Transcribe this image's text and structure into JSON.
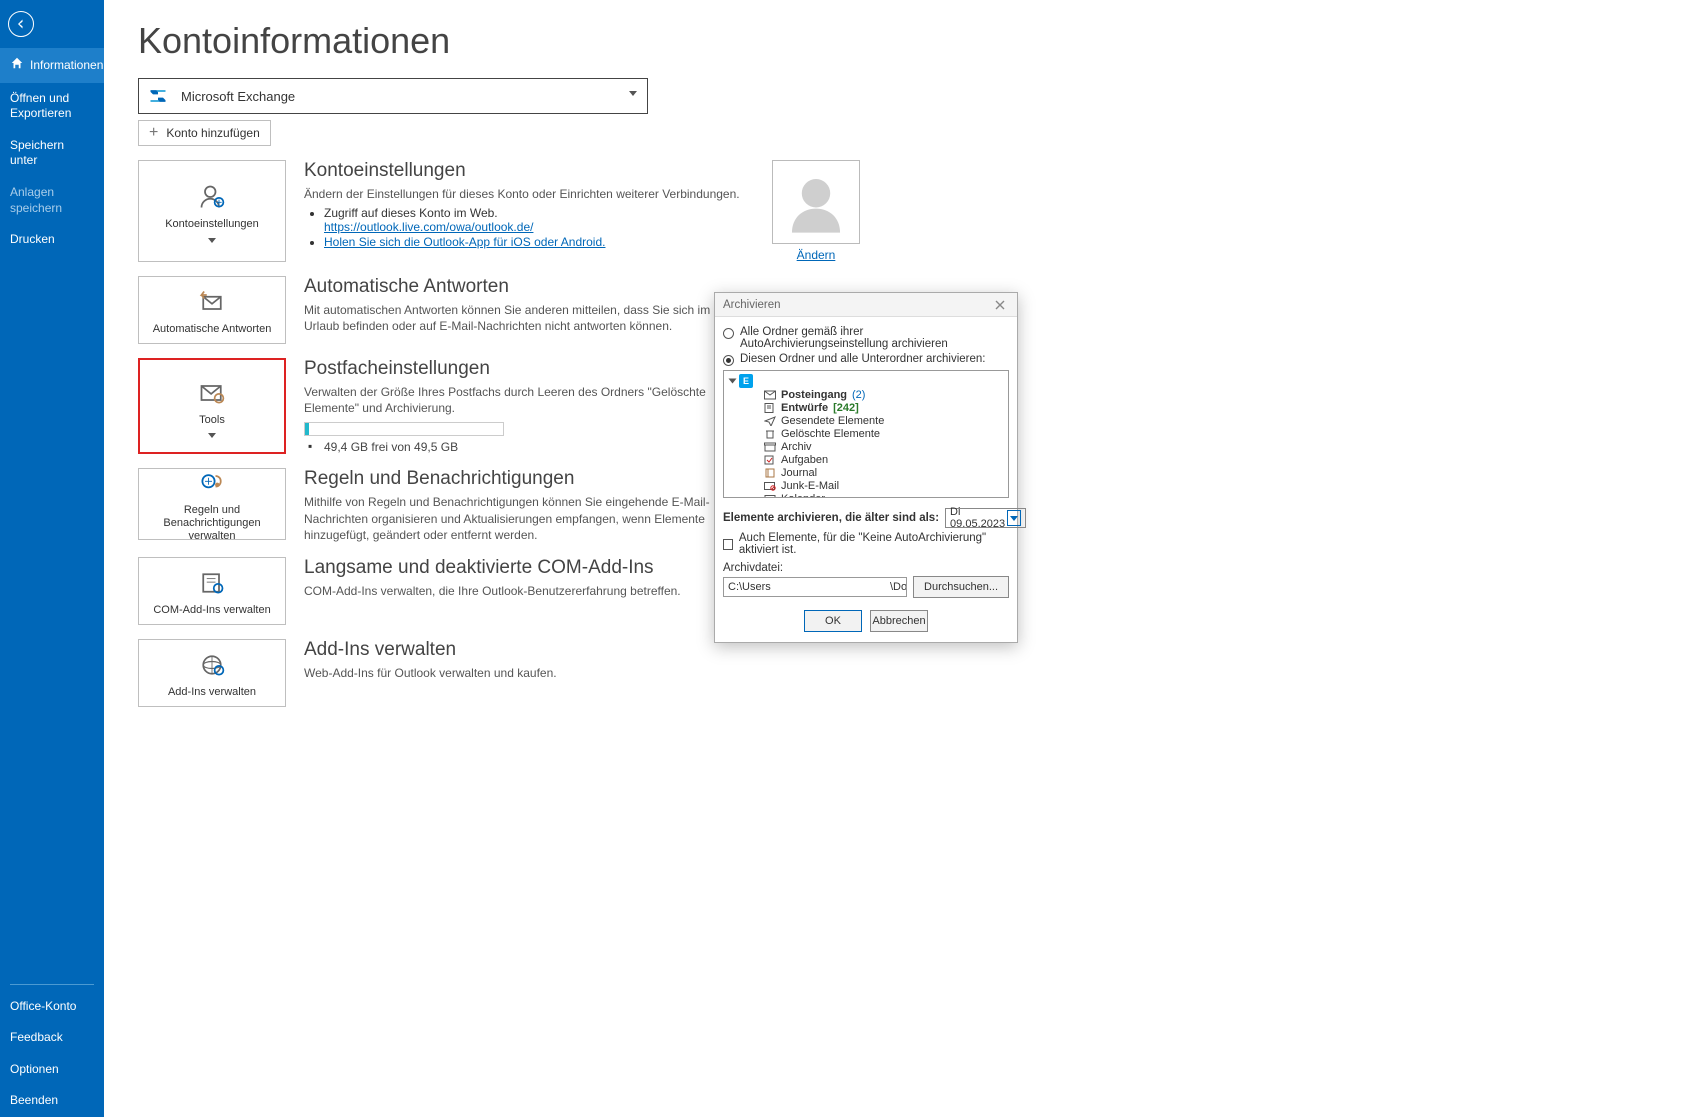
{
  "sidebar": {
    "items": [
      {
        "label": "Informationen",
        "selected": true,
        "icon": "home"
      },
      {
        "label": "Öffnen und Exportieren"
      },
      {
        "label": "Speichern unter"
      },
      {
        "label": "Anlagen speichern",
        "disabled": true
      },
      {
        "label": "Drucken"
      }
    ],
    "bottom_items": [
      {
        "label": "Office-Konto"
      },
      {
        "label": "Feedback"
      },
      {
        "label": "Optionen"
      },
      {
        "label": "Beenden"
      }
    ]
  },
  "page": {
    "title": "Kontoinformationen",
    "account_selector": {
      "label": "Microsoft Exchange"
    },
    "add_account": "Konto hinzufügen"
  },
  "sections": {
    "konto": {
      "tile": "Kontoeinstellungen",
      "title": "Kontoeinstellungen",
      "desc": "Ändern der Einstellungen für dieses Konto oder Einrichten weiterer Verbindungen.",
      "bullet1": "Zugriff auf dieses Konto im Web.",
      "link1": "https://outlook.live.com/owa/outlook.de/",
      "link2": "Holen Sie sich die Outlook-App für iOS oder Android.",
      "change": "Ändern"
    },
    "auto": {
      "tile": "Automatische Antworten",
      "title": "Automatische Antworten",
      "desc": "Mit automatischen Antworten können Sie anderen mitteilen, dass Sie sich im Urlaub befinden oder auf E-Mail-Nachrichten nicht antworten können."
    },
    "postfach": {
      "tile": "Tools",
      "title": "Postfacheinstellungen",
      "desc": "Verwalten der Größe Ihres Postfachs durch Leeren des Ordners \"Gelöschte Elemente\" und Archivierung.",
      "progress_text": "49,4 GB frei von 49,5 GB"
    },
    "regeln": {
      "tile": "Regeln und Benachrichtigungen verwalten",
      "title": "Regeln und Benachrichtigungen",
      "desc": "Mithilfe von Regeln und Benachrichtigungen können Sie eingehende E-Mail-Nachrichten organisieren und Aktualisierungen empfangen, wenn Elemente hinzugefügt, geändert oder entfernt werden."
    },
    "com": {
      "tile": "COM-Add-Ins verwalten",
      "title": "Langsame und deaktivierte COM-Add-Ins",
      "desc": "COM-Add-Ins verwalten, die Ihre Outlook-Benutzererfahrung betreffen."
    },
    "addins": {
      "tile": "Add-Ins verwalten",
      "title": "Add-Ins verwalten",
      "desc": "Web-Add-Ins für Outlook verwalten und kaufen."
    }
  },
  "dialog": {
    "title": "Archivieren",
    "radio1": "Alle Ordner gemäß ihrer AutoArchivierungseinstellung archivieren",
    "radio2": "Diesen Ordner und alle Unterordner archivieren:",
    "tree": [
      {
        "label": "Posteingang",
        "count": "(2)",
        "bold": true,
        "icon": "mail"
      },
      {
        "label": "Entwürfe",
        "count": "[242]",
        "bold": true,
        "icon": "draft"
      },
      {
        "label": "Gesendete Elemente",
        "icon": "sent"
      },
      {
        "label": "Gelöschte Elemente",
        "icon": "trash"
      },
      {
        "label": "Archiv",
        "icon": "archive"
      },
      {
        "label": "Aufgaben",
        "icon": "task"
      },
      {
        "label": "Journal",
        "icon": "journal"
      },
      {
        "label": "Junk-E-Mail",
        "icon": "junk"
      },
      {
        "label": "Kalender",
        "icon": "calendar"
      }
    ],
    "older_label": "Elemente archivieren, die älter sind als:",
    "older_date": "Di 09.05.2023",
    "checkbox": "Auch Elemente, für die \"Keine AutoArchivierung\" aktiviert ist.",
    "file_label": "Archivdatei:",
    "file_value": "C:\\Users                                       \\Documents\\Outlook-",
    "browse": "Durchsuchen...",
    "ok": "OK",
    "cancel": "Abbrechen"
  }
}
